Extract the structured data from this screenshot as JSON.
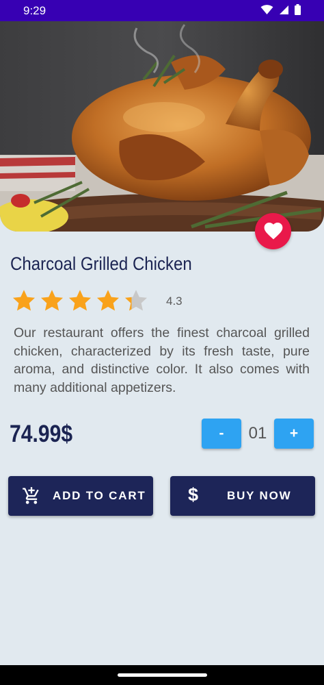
{
  "status_bar": {
    "time": "9:29",
    "icons": [
      "wifi-icon",
      "signal-icon",
      "battery-icon"
    ]
  },
  "hero": {
    "image": "roast-chicken-photo"
  },
  "product": {
    "name": "Charcoal Grilled Chicken",
    "rating": 4.3,
    "rating_label": "4.3",
    "rating_max": 5,
    "description": "Our restaurant offers the finest charcoal grilled chicken, characterized by its fresh taste, pure aroma, and distinctive color. It also comes with many additional appetizers.",
    "price": "74.99$"
  },
  "quantity": {
    "minus_label": "-",
    "value": "01",
    "plus_label": "+"
  },
  "actions": {
    "add_to_cart": {
      "label": "ADD TO CART",
      "icon": "add-cart-icon"
    },
    "buy_now": {
      "label": "BUY NOW",
      "icon": "dollar-icon",
      "icon_glyph": "$"
    }
  },
  "colors": {
    "status_bar": "#3700b3",
    "background": "#e1e9ef",
    "primary_dark": "#1d2558",
    "accent_blue": "#2ea3f2",
    "favorite": "#e9194a",
    "star": "#f9a21b"
  }
}
